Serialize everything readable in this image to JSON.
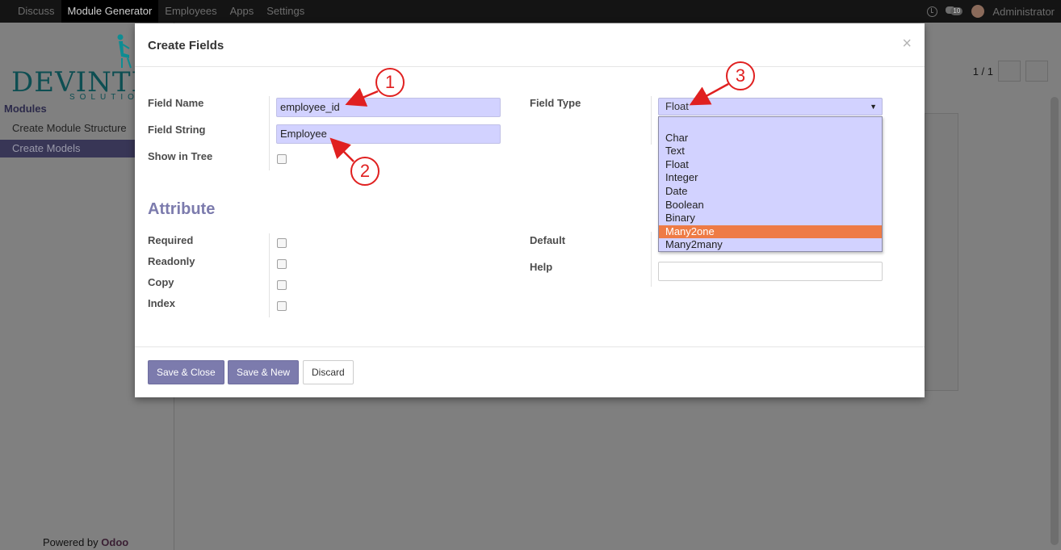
{
  "navbar": {
    "menu": [
      "Discuss",
      "Module Generator",
      "Employees",
      "Apps",
      "Settings"
    ],
    "active_index": 1,
    "notification_count": "10",
    "user": "Administrator"
  },
  "sidebar": {
    "logo_text": "DEVINTEL",
    "logo_sub": "SOLUTIO",
    "section": "Modules",
    "items": [
      {
        "label": "Create Module Structure"
      },
      {
        "label": "Create Models"
      }
    ],
    "powered_prefix": "Powered by",
    "powered_brand": "Odoo"
  },
  "pager": {
    "text": "1 / 1"
  },
  "dialog": {
    "title": "Create Fields",
    "close_glyph": "×",
    "field_name_label": "Field Name",
    "field_name_value": "employee_id",
    "field_string_label": "Field String",
    "field_string_value": "Employee",
    "show_in_tree_label": "Show in Tree",
    "field_type_label": "Field Type",
    "field_type_value": "Float",
    "type_options": [
      "",
      "Char",
      "Text",
      "Float",
      "Integer",
      "Date",
      "Boolean",
      "Binary",
      "Many2one",
      "Many2many"
    ],
    "highlighted_option": "Many2one",
    "attribute_title": "Attribute",
    "required_label": "Required",
    "readonly_label": "Readonly",
    "copy_label": "Copy",
    "index_label": "Index",
    "default_label": "Default",
    "help_label": "Help",
    "save_close": "Save & Close",
    "save_new": "Save & New",
    "discard": "Discard"
  },
  "annotations": {
    "one": "1",
    "two": "2",
    "three": "3"
  },
  "colors": {
    "primary": "#7c7bad",
    "highlight": "#ee7b45",
    "input_bg": "#d2d2ff",
    "annotation": "#e02020"
  }
}
